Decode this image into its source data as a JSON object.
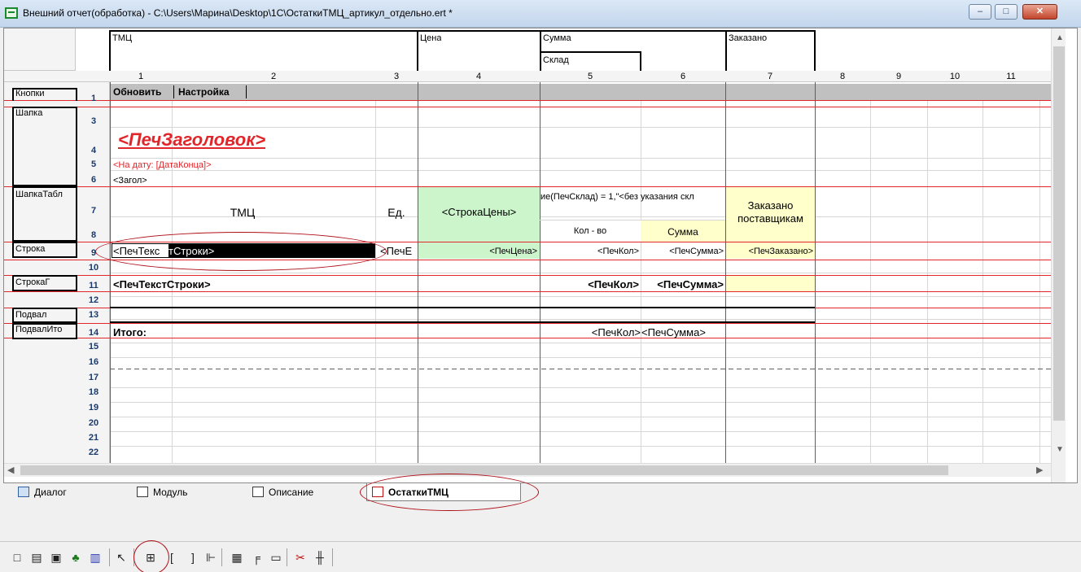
{
  "window": {
    "title": "Внешний отчет(обработка) - C:\\Users\\Марина\\Desktop\\1С\\ОстаткиТМЦ_артикул_отдельно.ert *",
    "buttons": {
      "minimize": "–",
      "maximize": "□",
      "close": "✕"
    }
  },
  "sheet": {
    "column_groups": [
      {
        "label": "ТМЦ"
      },
      {
        "label": "Цена"
      },
      {
        "label": "Сумма"
      },
      {
        "label": "Склад"
      },
      {
        "label": "Заказано"
      }
    ],
    "column_numbers": [
      "1",
      "2",
      "3",
      "4",
      "5",
      "6",
      "7",
      "8",
      "9",
      "10",
      "11"
    ],
    "row_numbers": [
      "1",
      "3",
      "4",
      "5",
      "6",
      "7",
      "8",
      "9",
      "10",
      "11",
      "12",
      "13",
      "14",
      "15",
      "16",
      "17",
      "18",
      "19",
      "20",
      "21",
      "22"
    ],
    "section_labels": {
      "buttons": "Кнопки",
      "header": "Шапка",
      "table_header": "ШапкаТабл",
      "row": "Строка",
      "row_group": "СтрокаГ",
      "footer": "Подвал",
      "footer_totals": "ПодвалИто"
    },
    "cells": {
      "btn_refresh": "Обновить",
      "btn_settings": "Настройка",
      "print_title": "<ПечЗаголовок>",
      "on_date": "<На дату: [ДатаКонца]>",
      "title_tag": "<Загол>",
      "col_tmc": "ТМЦ",
      "col_unit": "Ед.",
      "price_row": "<СтрокаЦены>",
      "formula": "ие(ПечСклад) = 1,\"<без указания скл",
      "qty": "Кол - во",
      "sum": "Сумма",
      "ordered": "Заказано поставщикам",
      "row_text_a": "<ПечТекс",
      "row_text_b": "тСтроки>",
      "row_unit": "<ПечЕ",
      "row_price": "<ПечЦена>",
      "row_qty": "<ПечКол>",
      "row_sum": "<ПечСумма>",
      "row_ordered": "<ПечЗаказано>",
      "group_text": "<ПечТекстСтроки>",
      "group_qty": "<ПечКол>",
      "group_sum": "<ПечСумма>",
      "total_label": "Итого:",
      "total_qty": "<ПечКол>",
      "total_sum": "<ПечСумма>"
    },
    "colors": {
      "red_line": "#e0262a",
      "green_fill": "#ccf5cc",
      "yellow_fill": "#ffffcc",
      "row1_bg": "#c0c0c0"
    }
  },
  "tabs": [
    {
      "label": "Диалог",
      "icon": "dialog-icon"
    },
    {
      "label": "Модуль",
      "icon": "module-icon"
    },
    {
      "label": "Описание",
      "icon": "description-icon"
    },
    {
      "label": "ОстаткиТМЦ",
      "icon": "table-icon",
      "active": true
    }
  ],
  "toolbar": {
    "icons": [
      "rectangle-icon",
      "text-icon",
      "picture-icon",
      "ole-object-icon",
      "chart-icon",
      "pointer-icon",
      "insert-cell-icon",
      "left-bracket-icon",
      "right-bracket-icon",
      "group-icon",
      "grid-icon",
      "header-icon",
      "ruler-icon",
      "delete-icon",
      "split-icon"
    ],
    "glyphs": [
      "□",
      "▤",
      "▣",
      "♣",
      "▥",
      "↖",
      "⊞",
      "[",
      "]",
      "⊩",
      "▦",
      "╒",
      "▭",
      "✂",
      "╫"
    ]
  }
}
